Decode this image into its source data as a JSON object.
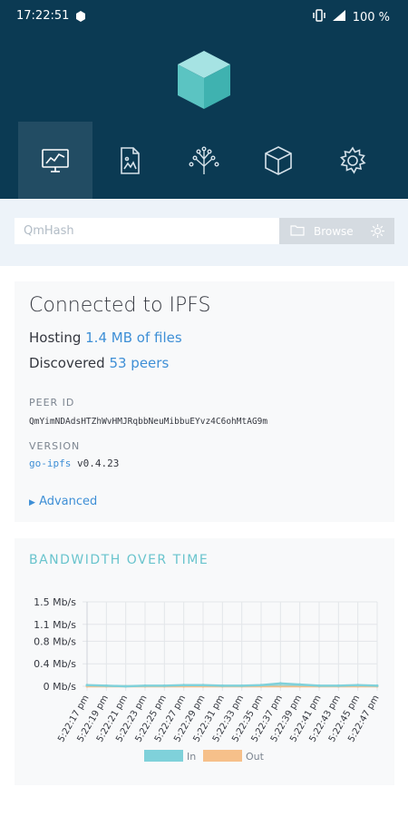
{
  "status": {
    "time": "17:22:51",
    "battery": "100 %"
  },
  "search": {
    "placeholder": "QmHash",
    "browse_label": "Browse"
  },
  "status_card": {
    "title": "Connected to IPFS",
    "hosting_prefix": "Hosting",
    "hosting_link": "1.4 MB of files",
    "discovered_prefix": "Discovered",
    "discovered_link": "53 peers",
    "peer_id_label": "PEER ID",
    "peer_id": "QmYimNDAdsHTZhWvHMJRqbbNeuMibbuEYvz4C6ohMtAG9m",
    "version_label": "VERSION",
    "version_name": "go-ipfs",
    "version_number": "v0.4.23",
    "advanced_label": "Advanced"
  },
  "chart_data": {
    "type": "area",
    "title": "BANDWIDTH OVER TIME",
    "y_ticks": [
      "1.5 Mb/s",
      "1.1 Mb/s",
      "0.8 Mb/s",
      "0.4 Mb/s",
      "0 Mb/s"
    ],
    "ylim": [
      0,
      1.5
    ],
    "categories": [
      "5:22:17 pm",
      "5:22:19 pm",
      "5:22:21 pm",
      "5:22:23 pm",
      "5:22:25 pm",
      "5:22:27 pm",
      "5:22:29 pm",
      "5:22:31 pm",
      "5:22:33 pm",
      "5:22:35 pm",
      "5:22:37 pm",
      "5:22:39 pm",
      "5:22:41 pm",
      "5:22:43 pm",
      "5:22:45 pm",
      "5:22:47 pm"
    ],
    "series": [
      {
        "name": "In",
        "color": "#7fd1da",
        "values": [
          0.02,
          0.01,
          0,
          0.01,
          0.01,
          0.02,
          0.02,
          0.01,
          0.01,
          0.02,
          0.05,
          0.03,
          0.01,
          0.01,
          0.02,
          0.01
        ]
      },
      {
        "name": "Out",
        "color": "#f6c08a",
        "values": [
          0,
          0,
          0,
          0,
          0,
          0,
          0,
          0,
          0,
          0,
          0,
          0,
          0,
          0,
          0,
          0
        ]
      }
    ],
    "grid": true,
    "legend": "bottom"
  }
}
